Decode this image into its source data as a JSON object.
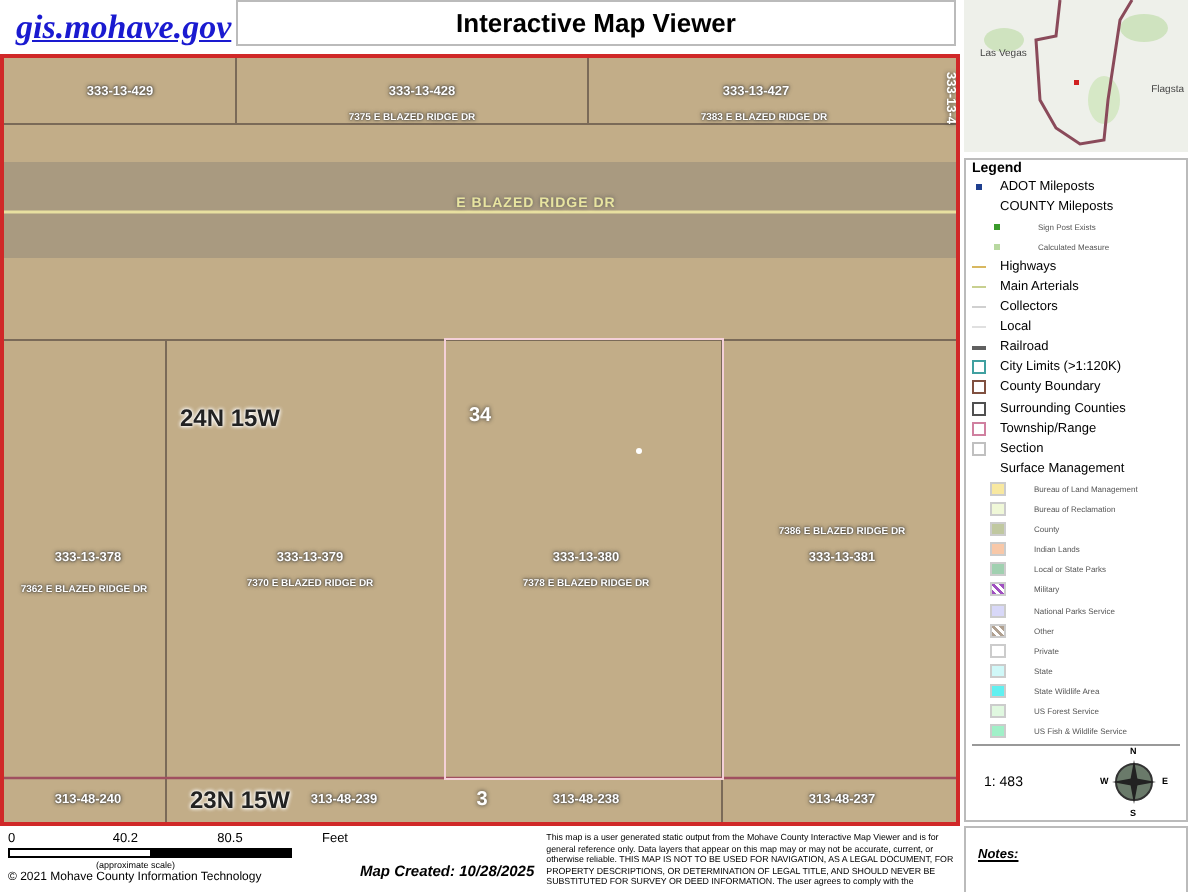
{
  "header": {
    "site_link": "gis.mohave.gov",
    "title": "Interactive Map Viewer"
  },
  "overview_map": {
    "labels": [
      "Las Vegas",
      "Flagsta"
    ]
  },
  "map": {
    "labels": [
      {
        "kind": "parcel",
        "text": "333-13-429"
      },
      {
        "kind": "parcel",
        "text": "333-13-428"
      },
      {
        "kind": "address",
        "text": "7375 E BLAZED RIDGE DR"
      },
      {
        "kind": "parcel",
        "text": "333-13-427"
      },
      {
        "kind": "address",
        "text": "7383 E BLAZED RIDGE DR"
      },
      {
        "kind": "vertical",
        "text": "333-13-4"
      },
      {
        "kind": "road",
        "text": "E BLAZED RIDGE DR"
      },
      {
        "kind": "township",
        "text": "24N 15W"
      },
      {
        "kind": "section",
        "text": "34"
      },
      {
        "kind": "parcel",
        "text": "333-13-378"
      },
      {
        "kind": "address",
        "text": "7362 E BLAZED RIDGE DR"
      },
      {
        "kind": "parcel",
        "text": "333-13-379"
      },
      {
        "kind": "address",
        "text": "7370 E BLAZED RIDGE DR"
      },
      {
        "kind": "parcel",
        "text": "333-13-380"
      },
      {
        "kind": "address",
        "text": "7378 E BLAZED RIDGE DR"
      },
      {
        "kind": "address",
        "text": "7386 E BLAZED RIDGE DR"
      },
      {
        "kind": "parcel",
        "text": "333-13-381"
      },
      {
        "kind": "parcel",
        "text": "313-48-240"
      },
      {
        "kind": "township",
        "text": "23N 15W"
      },
      {
        "kind": "parcel",
        "text": "313-48-239"
      },
      {
        "kind": "section",
        "text": "3"
      },
      {
        "kind": "parcel",
        "text": "313-48-238"
      },
      {
        "kind": "parcel",
        "text": "313-48-237"
      }
    ]
  },
  "legend": {
    "title": "Legend",
    "items": [
      {
        "kind": "point",
        "label": "ADOT Mileposts",
        "color": "#1f3f8f"
      },
      {
        "kind": "heading",
        "label": "COUNTY Mileposts"
      },
      {
        "kind": "small-point",
        "label": "Sign Post Exists",
        "color": "#3a9a2a"
      },
      {
        "kind": "small-point",
        "label": "Calculated Measure",
        "color": "#b8d8a0"
      },
      {
        "kind": "line",
        "label": "Highways",
        "color": "#d8b860"
      },
      {
        "kind": "line",
        "label": "Main Arterials",
        "color": "#c8d090"
      },
      {
        "kind": "line",
        "label": "Collectors",
        "color": "#d0d0d0"
      },
      {
        "kind": "line",
        "label": "Local",
        "color": "#e0e0e0"
      },
      {
        "kind": "line",
        "label": "Railroad",
        "color": "#606060"
      },
      {
        "kind": "outline",
        "label": "City Limits (>1:120K)",
        "color": "#40a0a0"
      },
      {
        "kind": "outline",
        "label": "County Boundary",
        "color": "#805040"
      },
      {
        "kind": "outline",
        "label": "Surrounding Counties",
        "color": "#505050"
      },
      {
        "kind": "outline",
        "label": "Township/Range",
        "color": "#d080a0"
      },
      {
        "kind": "outline",
        "label": "Section",
        "color": "#c0c0c0"
      },
      {
        "kind": "heading",
        "label": "Surface Management"
      },
      {
        "kind": "fill",
        "label": "Bureau of Land Management",
        "color": "#f8e8a0"
      },
      {
        "kind": "fill",
        "label": "Bureau of Reclamation",
        "color": "#f0f8d8"
      },
      {
        "kind": "fill",
        "label": "County",
        "color": "#c0c8a0"
      },
      {
        "kind": "fill",
        "label": "Indian Lands",
        "color": "#f8c8a8"
      },
      {
        "kind": "fill",
        "label": "Local or State Parks",
        "color": "#a0d0b0"
      },
      {
        "kind": "hatch",
        "label": "Military",
        "color": "#a050c0"
      },
      {
        "kind": "fill",
        "label": "National Parks Service",
        "color": "#d8d8f8"
      },
      {
        "kind": "hatch",
        "label": "Other",
        "color": "#b0a090"
      },
      {
        "kind": "fill",
        "label": "Private",
        "color": "#ffffff"
      },
      {
        "kind": "fill",
        "label": "State",
        "color": "#d0f8f8"
      },
      {
        "kind": "fill",
        "label": "State Wildlife Area",
        "color": "#60f0f0"
      },
      {
        "kind": "fill",
        "label": "US Forest Service",
        "color": "#e0f8e0"
      },
      {
        "kind": "fill",
        "label": "US Fish & Wildlife Service",
        "color": "#a0f0c8"
      }
    ],
    "scale": "1: 483",
    "compass": [
      "N",
      "W",
      "E",
      "S"
    ]
  },
  "notes": {
    "title": "Notes:"
  },
  "footer": {
    "scale_ticks": [
      "0",
      "40.2",
      "80.5"
    ],
    "scale_unit": "Feet",
    "scale_note": "(approximate scale)",
    "copyright": "© 2021 Mohave County Information Technology",
    "map_created": "Map Created: 10/28/2025",
    "disclaimer": "This map is a user generated static output from the Mohave County Interactive Map Viewer and is for general reference only. Data layers that appear on this map may or may not be accurate, current, or otherwise reliable. THIS MAP IS NOT TO BE USED FOR NAVIGATION, AS A LEGAL DOCUMENT, FOR PROPERTY DESCRIPTIONS, OR DETERMINATION OF LEGAL TITLE, AND SHOULD NEVER BE SUBSTITUTED FOR SURVEY OR DEED INFORMATION. The user agrees to comply with the"
  }
}
